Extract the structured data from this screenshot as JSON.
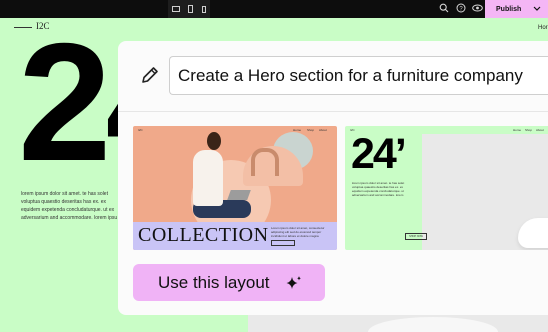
{
  "toolbar": {
    "device_icons": [
      "desktop-icon",
      "tablet-icon",
      "mobile-icon"
    ],
    "action_icons": [
      "search-icon",
      "help-icon",
      "preview-eye-icon"
    ],
    "publish_label": "Publish",
    "publish_color": "#f4b6f5"
  },
  "site": {
    "logo": "I2C",
    "nav_link": "Hor",
    "hero_number": "24",
    "lorem_lines": [
      "lorem ipsum dolor sit amet. te has solet",
      "voluptua quaestio deseritas has ex. ex",
      "equidem expetenda concludaturque. ut ex",
      "adversarium and accommodare. lorem ipsu"
    ],
    "background_color": "#c9fdc6"
  },
  "prompt": {
    "text": "Create a Hero section for a furniture company",
    "icon": "pencil-icon"
  },
  "layouts": [
    {
      "heading": "COLLECTION",
      "nav": [
        "I2C",
        "Home",
        "Shop",
        "About"
      ],
      "body_lines": [
        "Lorem ipsum dolor sit amet, consectetur",
        "adipiscing elit sed do eiusmod tempor",
        "incididunt ut labore et dolore magna"
      ],
      "button": "SHOP NOW",
      "accent_color": "#c9c4f6",
      "photo_color": "#f0a98a"
    },
    {
      "heading": "24’",
      "nav": [
        "I2C",
        "Home",
        "Shop",
        "About"
      ],
      "body_lines": [
        "lorem ipsum dolor sit amet. te has solet",
        "voluptua quaestio deseritas has ex. ex",
        "equidem expetenda concludaturque. ut",
        "adversarium and accommodare. lorem"
      ],
      "button": "SHOP NOW",
      "accent_color": "#c9fdc6"
    }
  ],
  "cta": {
    "label": "Use this layout",
    "icon": "sparkle-icon",
    "color": "#f0b3f6"
  }
}
